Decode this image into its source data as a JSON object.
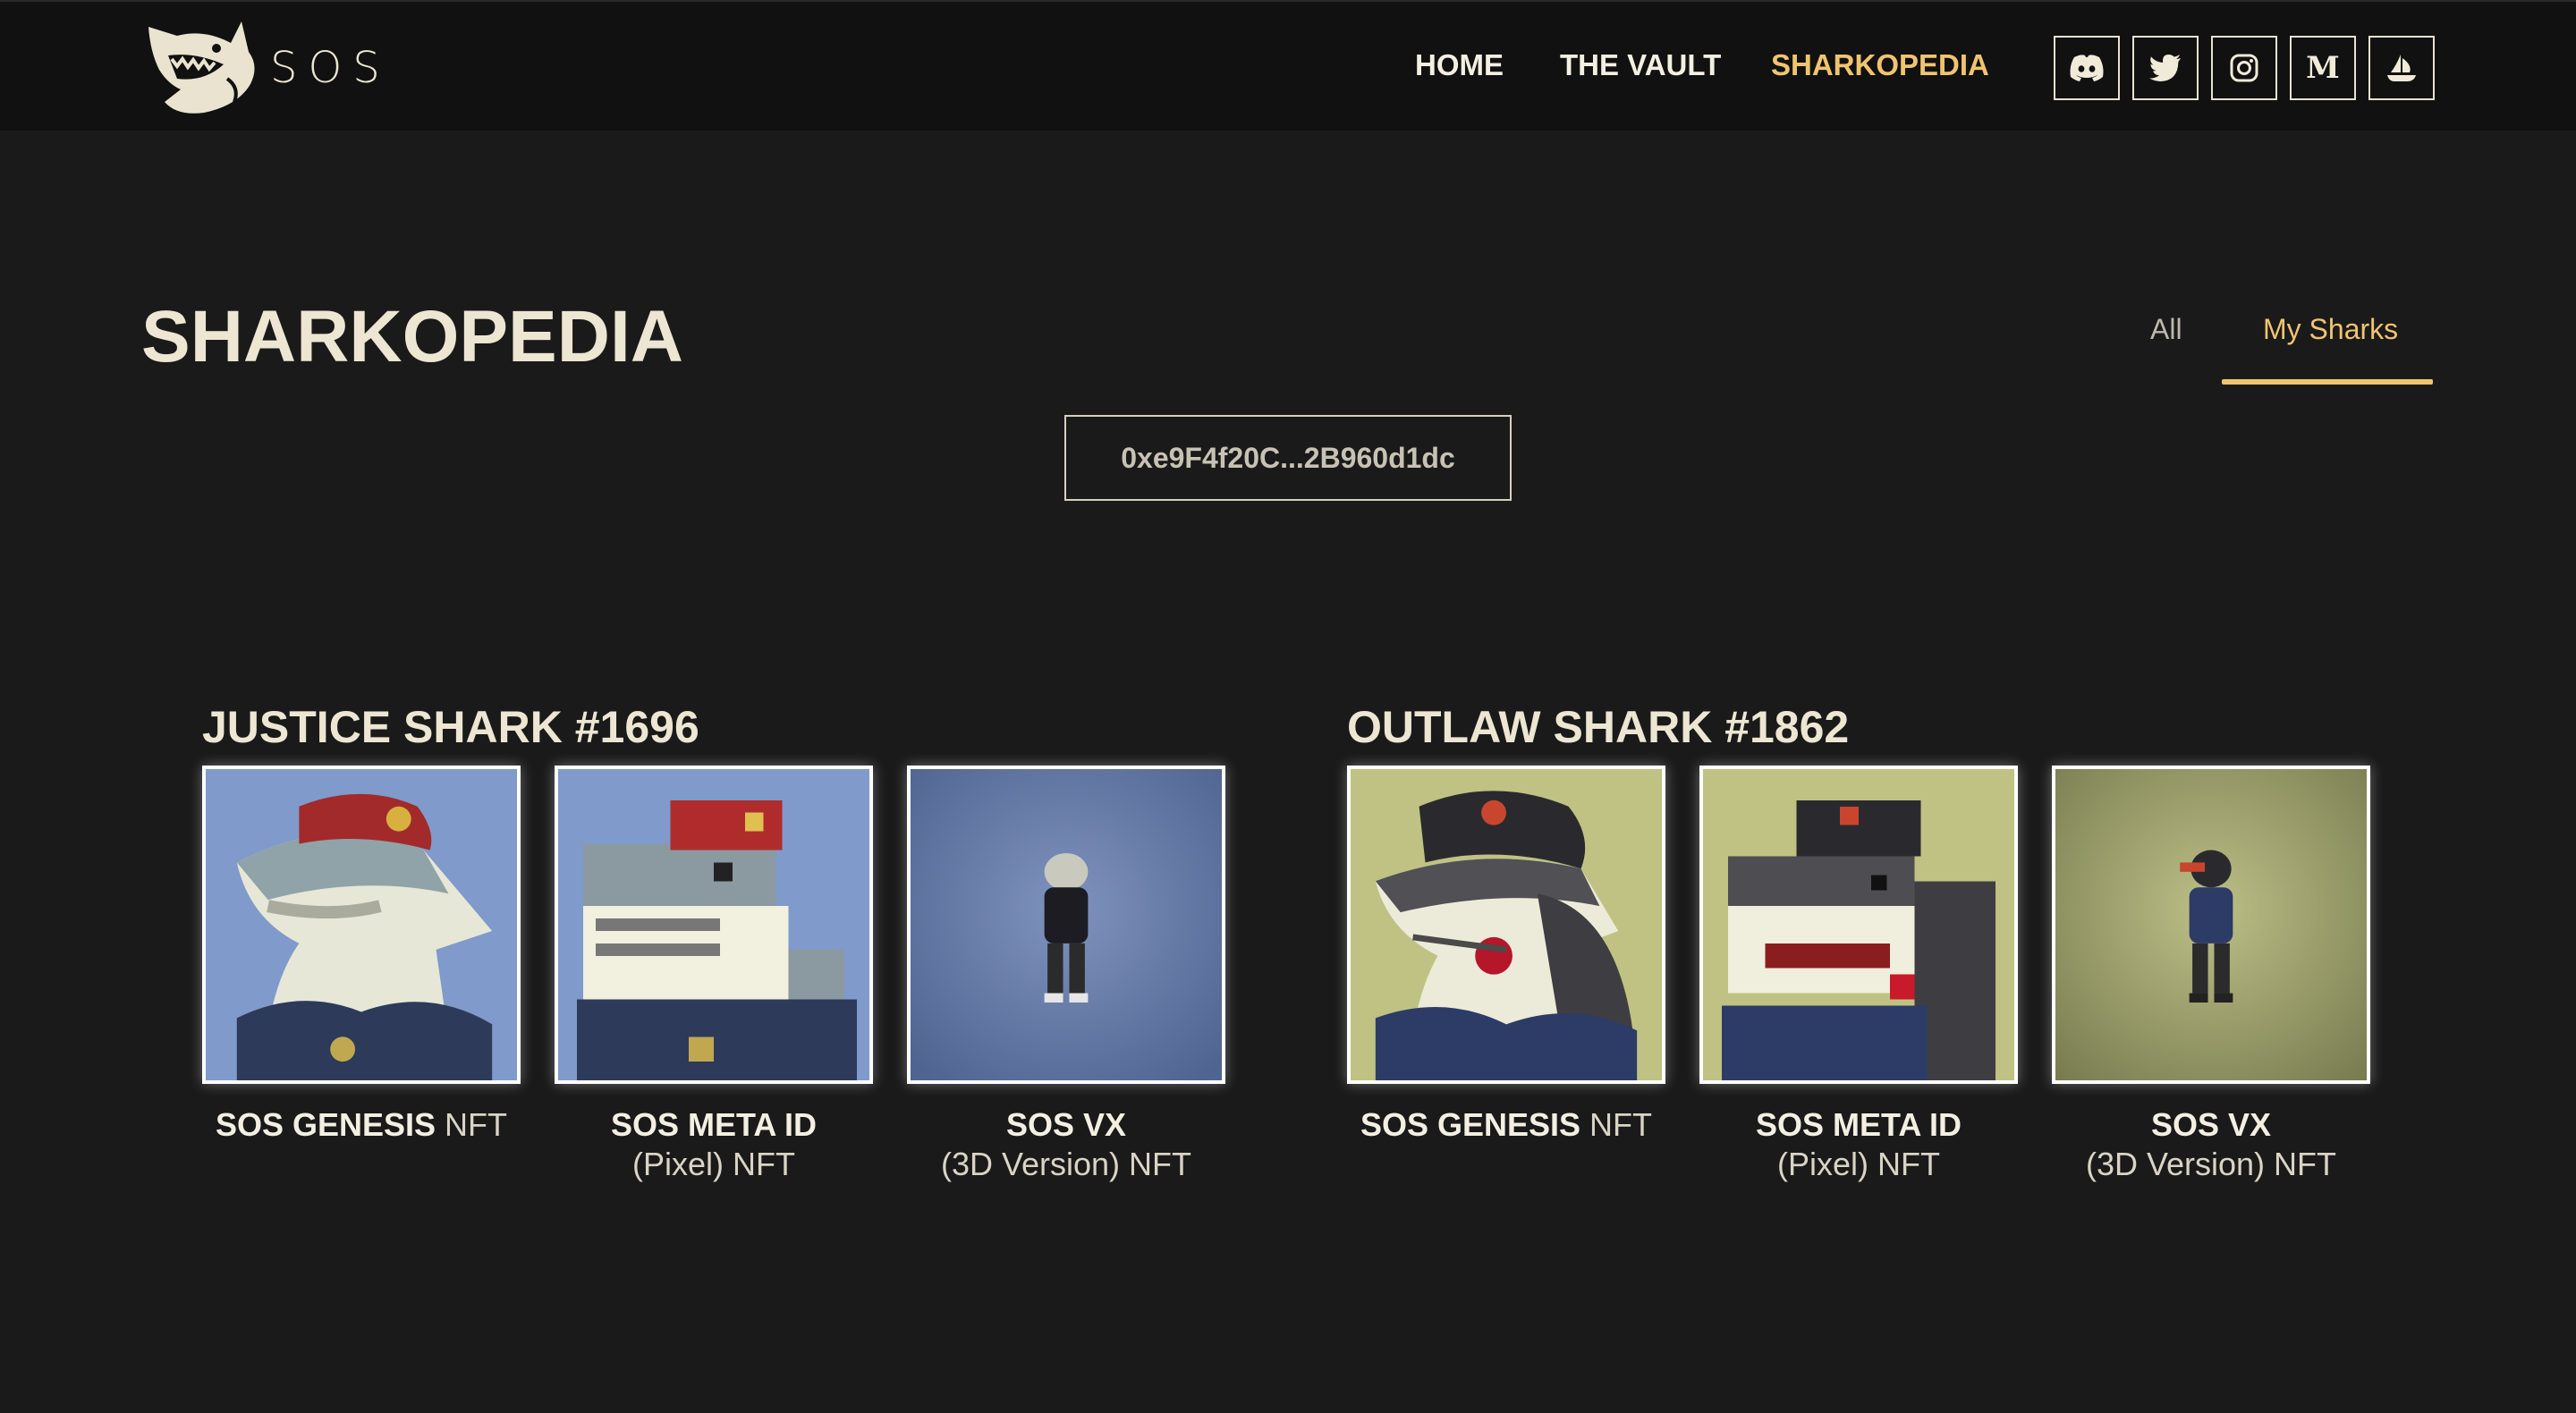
{
  "brand": {
    "logo_text": "SOS",
    "logo_icon": "shark-logo-icon"
  },
  "nav": {
    "home": "HOME",
    "vault": "THE VAULT",
    "sharkopedia": "SHARKOPEDIA"
  },
  "social": [
    {
      "name": "discord-icon"
    },
    {
      "name": "twitter-icon"
    },
    {
      "name": "instagram-icon"
    },
    {
      "name": "medium-icon",
      "glyph": "M"
    },
    {
      "name": "opensea-icon"
    }
  ],
  "page": {
    "title": "SHARKOPEDIA",
    "tabs": {
      "all": "All",
      "my_sharks": "My Sharks"
    },
    "active_tab": "My Sharks",
    "wallet": "0xe9F4f20C...2B960d1dc"
  },
  "groups": [
    {
      "title": "JUSTICE SHARK #1696",
      "cards": [
        {
          "name_bold": "SOS GENESIS",
          "name_light": " NFT",
          "sub": ""
        },
        {
          "name_bold": "SOS META ID",
          "name_light": "",
          "sub": "(Pixel) NFT"
        },
        {
          "name_bold": "SOS VX",
          "name_light": "",
          "sub": "(3D Version) NFT"
        }
      ]
    },
    {
      "title": "OUTLAW SHARK #1862",
      "cards": [
        {
          "name_bold": "SOS GENESIS",
          "name_light": " NFT",
          "sub": ""
        },
        {
          "name_bold": "SOS META ID",
          "name_light": "",
          "sub": "(Pixel) NFT"
        },
        {
          "name_bold": "SOS VX",
          "name_light": "",
          "sub": "(3D Version) NFT"
        }
      ]
    }
  ],
  "colors": {
    "background": "#1a1a1a",
    "header": "#111111",
    "accent": "#f0c46f",
    "text": "#ece6d2",
    "justice_bg": "#7f9acb",
    "outlaw_bg": "#bfc283"
  }
}
